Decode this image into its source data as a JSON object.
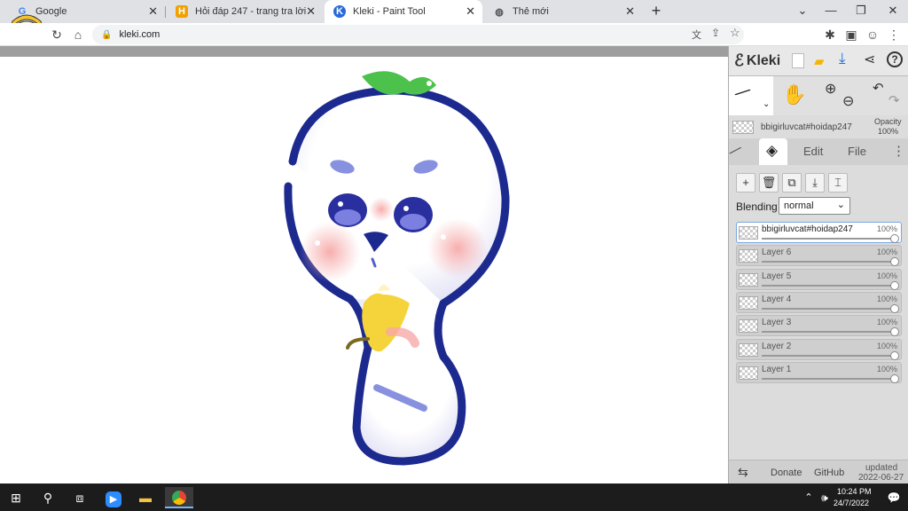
{
  "browser": {
    "tabs": [
      {
        "title": "Google",
        "icon": "google-icon",
        "icon_glyph": "G",
        "icon_color": "#4285f4"
      },
      {
        "title": "Hỏi đáp 247 - trang tra lời",
        "icon": "hoidap-icon",
        "icon_glyph": "H",
        "icon_color": "#f0a000"
      },
      {
        "title": "Kleki - Paint Tool",
        "icon": "kleki-icon",
        "icon_glyph": "K",
        "icon_color": "#2a6ad8"
      },
      {
        "title": "Thẻ mới",
        "icon": "globe-icon",
        "icon_glyph": "◍",
        "icon_color": "#555"
      }
    ],
    "new_tab_label": "+",
    "url": "kleki.com"
  },
  "app": {
    "logo_text": "Kleki",
    "brush_name": "bbigirluvcat#hoidap247",
    "opacity_label": "Opacity",
    "opacity_value": "100%",
    "tabs": {
      "edit": "Edit",
      "file": "File"
    },
    "blending_label": "Blending",
    "blending_value": "normal",
    "layers": [
      {
        "name": "bbigirluvcat#hoidap247",
        "opacity": "100%",
        "active": true
      },
      {
        "name": "Layer 6",
        "opacity": "100%",
        "active": false
      },
      {
        "name": "Layer 5",
        "opacity": "100%",
        "active": false
      },
      {
        "name": "Layer 4",
        "opacity": "100%",
        "active": false
      },
      {
        "name": "Layer 3",
        "opacity": "100%",
        "active": false
      },
      {
        "name": "Layer 2",
        "opacity": "100%",
        "active": false
      },
      {
        "name": "Layer 1",
        "opacity": "100%",
        "active": false
      }
    ],
    "footer": {
      "donate": "Donate",
      "github": "GitHub",
      "updated_label": "updated",
      "updated_date": "2022-06-27"
    }
  },
  "taskbar": {
    "time": "10:24 PM",
    "date": "24/7/2022"
  },
  "colors": {
    "accent": "#1a73e8",
    "drawing_blue": "#1c2a8f",
    "leaf_green": "#4cc24c",
    "cheek_pink": "#f7b3b3",
    "banana_yellow": "#f5d33a"
  }
}
